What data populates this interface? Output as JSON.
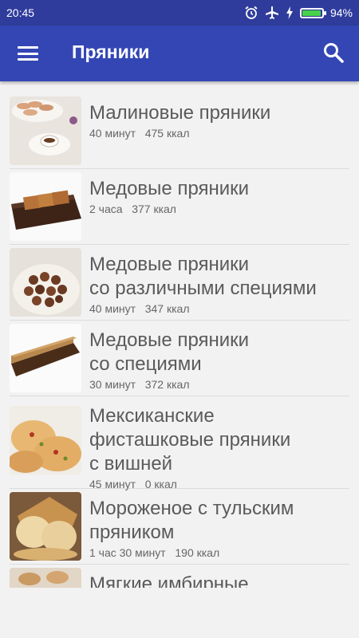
{
  "status": {
    "time": "20:45",
    "battery": "94%",
    "battery_level": 0.94
  },
  "appbar": {
    "title": "Пряники"
  },
  "recipes": [
    {
      "title": "Малиновые пряники",
      "time": "40 минут",
      "kcal": "475 ккал"
    },
    {
      "title": "Медовые пряники",
      "time": "2 часа",
      "kcal": "377 ккал"
    },
    {
      "title": "Медовые пряники\nсо различными специями",
      "time": "40 минут",
      "kcal": "347 ккал"
    },
    {
      "title": "Медовые пряники\nсо специями",
      "time": "30 минут",
      "kcal": "372 ккал"
    },
    {
      "title": "Мексиканские\nфисташковые пряники\nс вишней",
      "time": "45 минут",
      "kcal": "0 ккал"
    },
    {
      "title": "Мороженое с тульским\nпряником",
      "time": "1 час 30 минут",
      "kcal": "190 ккал"
    },
    {
      "title": "Мягкие имбирные",
      "time": "",
      "kcal": ""
    }
  ]
}
